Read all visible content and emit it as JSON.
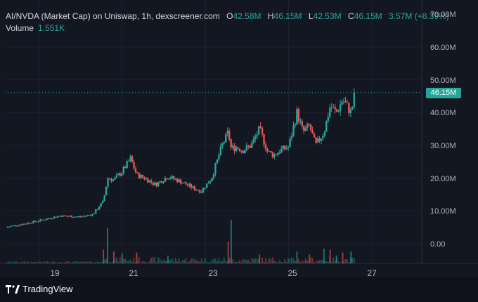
{
  "legend": {
    "symbol": "AI/NVDA (Market Cap) on Uniswap, 1h, dexscreener.com",
    "open_label": "O",
    "open": "42.58M",
    "high_label": "H",
    "high": "46.15M",
    "low_label": "L",
    "low": "42.53M",
    "close_label": "C",
    "close": "46.15M",
    "change": "3.57M (+8.39%)",
    "volume_label": "Volume",
    "volume": "1.551K"
  },
  "price_tag": "46.15M",
  "footer": {
    "brand": "TradingView"
  },
  "colors": {
    "up": "#26a69a",
    "down": "#ef5350",
    "background": "#131722"
  },
  "chart_data": {
    "type": "candlestick",
    "x_tick_labels": [
      "19",
      "21",
      "23",
      "25",
      "27"
    ],
    "y_tick_labels": [
      "70.00M",
      "60.00M",
      "50.00M",
      "40.00M",
      "30.00M",
      "20.00M",
      "10.00M",
      "0.00"
    ],
    "ylim": [
      0,
      70
    ],
    "xlim": [
      18.2,
      28.2
    ],
    "last_price": 46.15,
    "grid": true,
    "close_series": {
      "t": [
        18.2,
        19.0,
        19.5,
        20.0,
        20.3,
        20.55,
        20.65,
        20.8,
        21.0,
        21.2,
        21.35,
        21.55,
        21.8,
        22.1,
        22.4,
        22.7,
        22.9,
        23.15,
        23.4,
        23.55,
        23.62,
        23.75,
        23.9,
        24.1,
        24.3,
        24.5,
        24.65,
        24.8,
        25.0,
        25.2,
        25.35,
        25.5,
        25.65,
        25.75,
        25.85,
        26.0,
        26.15,
        26.3,
        26.5,
        26.6
      ],
      "v": [
        5.0,
        7.0,
        8.5,
        8.2,
        9.0,
        13.0,
        20.0,
        19.5,
        22.0,
        26.0,
        21.0,
        20.0,
        18.0,
        20.5,
        19.0,
        17.0,
        16.0,
        20.0,
        30.0,
        34.0,
        29.0,
        29.5,
        28.5,
        30.0,
        35.0,
        28.0,
        27.0,
        28.5,
        29.5,
        40.0,
        34.0,
        36.0,
        30.0,
        32.0,
        34.0,
        42.0,
        40.0,
        44.0,
        40.0,
        46.15
      ]
    },
    "volume_series": {
      "t": [
        20.55,
        20.65,
        20.8,
        21.0,
        21.35,
        22.1,
        23.55,
        23.62,
        24.3,
        25.2,
        25.5,
        25.85,
        26.0,
        26.15,
        26.3,
        26.5
      ],
      "v": [
        1.4,
        3.6,
        1.2,
        1.0,
        1.1,
        0.8,
        2.2,
        4.4,
        0.9,
        1.2,
        0.9,
        1.5,
        1.4,
        0.8,
        1.1,
        1.2
      ]
    }
  }
}
